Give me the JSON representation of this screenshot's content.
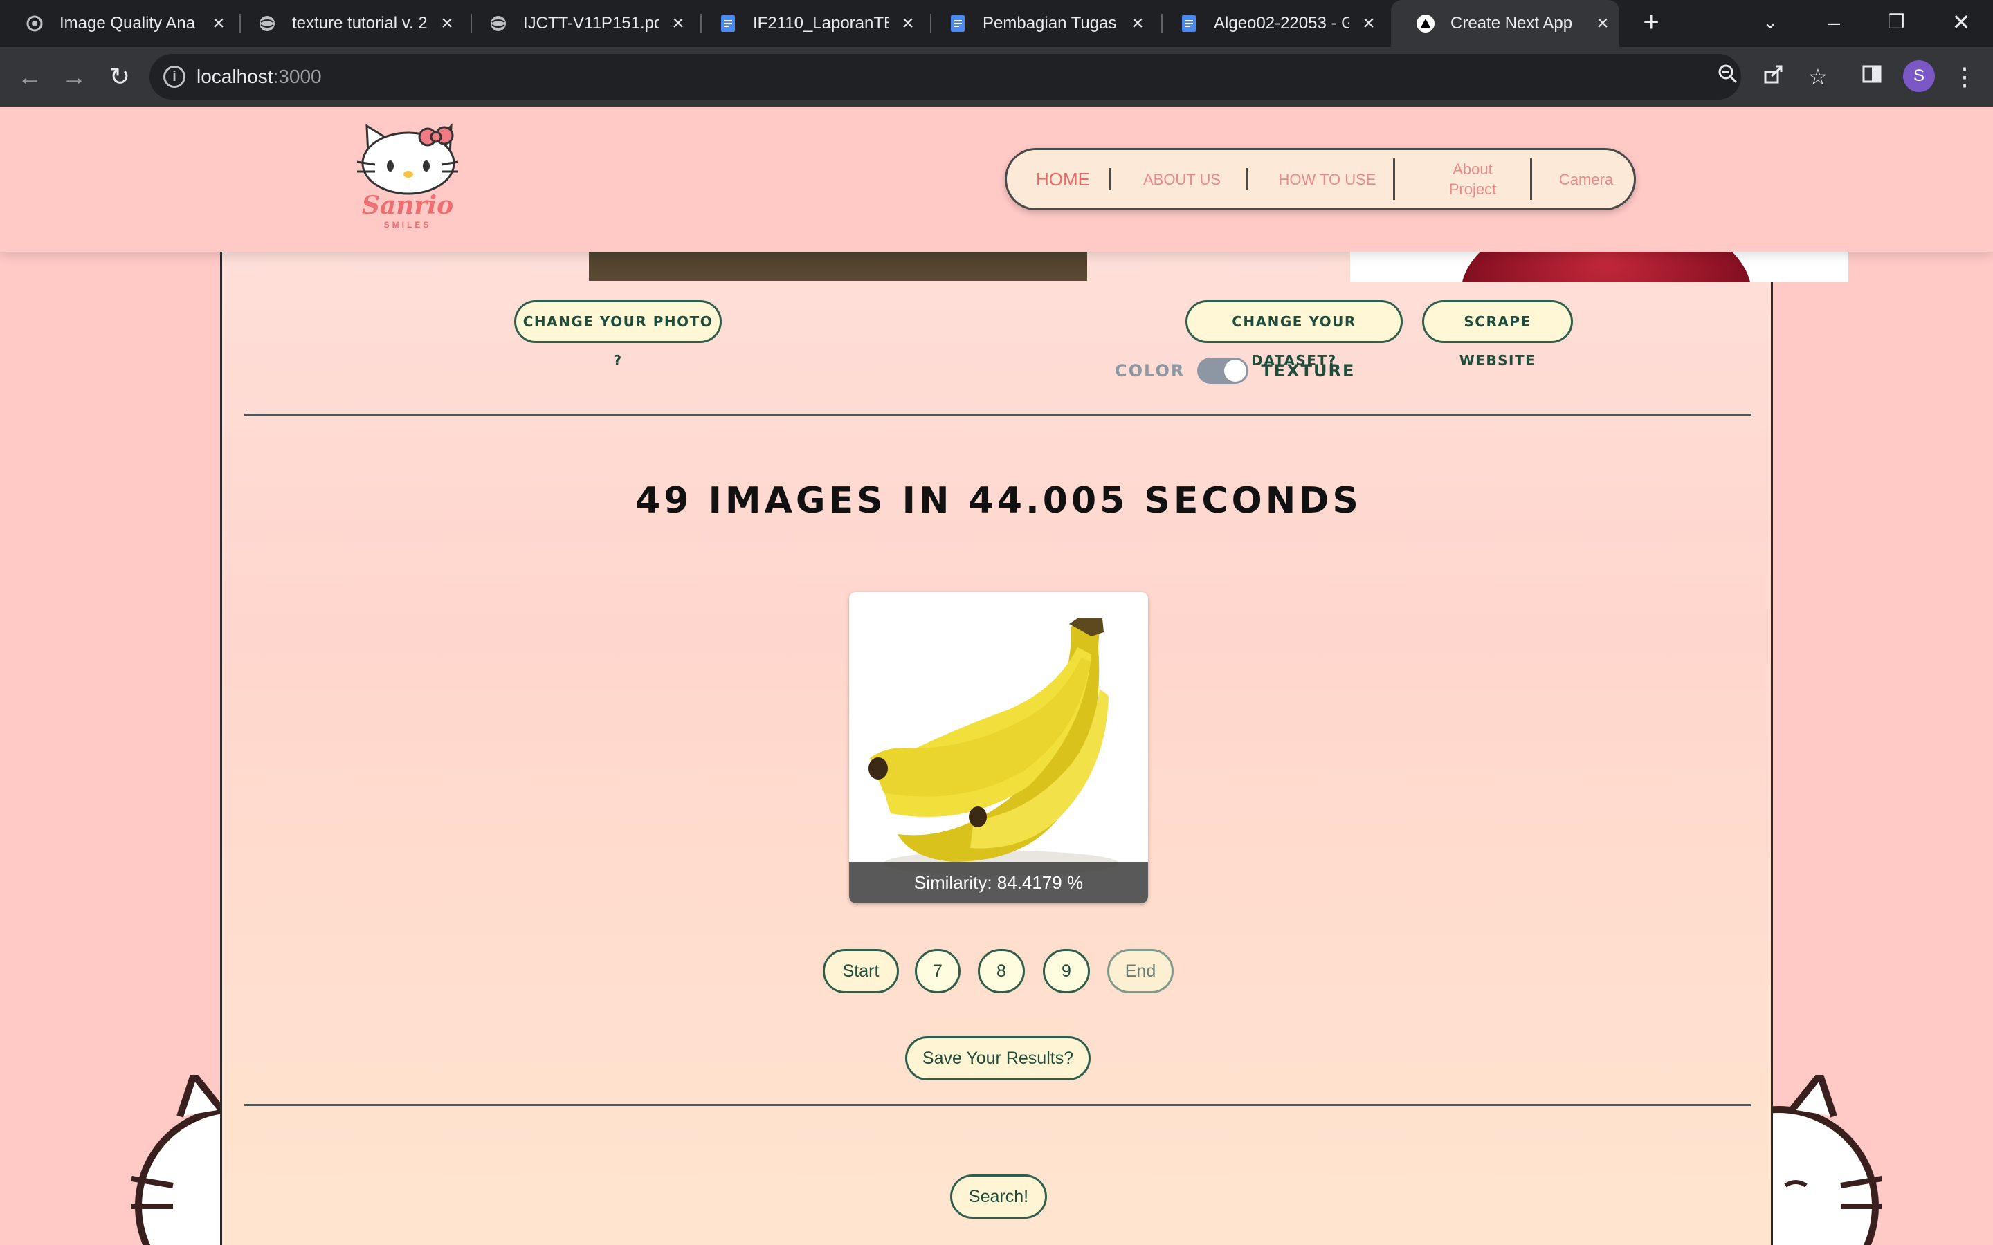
{
  "browser": {
    "tabs": [
      {
        "title": "Image Quality Ana",
        "active": false
      },
      {
        "title": "texture tutorial v. 2",
        "active": false
      },
      {
        "title": "IJCTT-V11P151.pdf",
        "active": false
      },
      {
        "title": "IF2110_LaporanTB",
        "active": false
      },
      {
        "title": "Pembagian Tugas",
        "active": false
      },
      {
        "title": "Algeo02-22053 - G",
        "active": false
      },
      {
        "title": "Create Next App",
        "active": true
      }
    ],
    "url_host": "localhost",
    "url_port": ":3000",
    "profile_initial": "S"
  },
  "header": {
    "logo_text": "Sanrio",
    "logo_sub": "SMILES",
    "nav": [
      {
        "label": "HOME",
        "active": true
      },
      {
        "label": "ABOUT US",
        "active": false
      },
      {
        "label": "HOW TO USE",
        "active": false
      },
      {
        "label": "About Project",
        "active": false
      },
      {
        "label": "Camera",
        "active": false
      }
    ]
  },
  "upload": {
    "change_photo": "CHANGE YOUR PHOTO ?",
    "change_dataset": "CHANGE YOUR DATASET?",
    "scrape": "SCRAPE WEBSITE",
    "toggle_left": "COLOR",
    "toggle_right": "TEXTURE",
    "toggle_state": "TEXTURE"
  },
  "results": {
    "headline": "49 IMAGES IN 44.005 SECONDS",
    "items": [
      {
        "similarity": "Similarity: 84.4179 %"
      }
    ],
    "pagination": [
      "Start",
      "7",
      "8",
      "9",
      "End"
    ],
    "save_label": "Save Your Results?"
  },
  "search": {
    "label": "Search!"
  },
  "colors": {
    "page_bg": "#ffc9c6",
    "accent_green": "#1e4d3c",
    "nav_pink": "#e88a8a"
  }
}
